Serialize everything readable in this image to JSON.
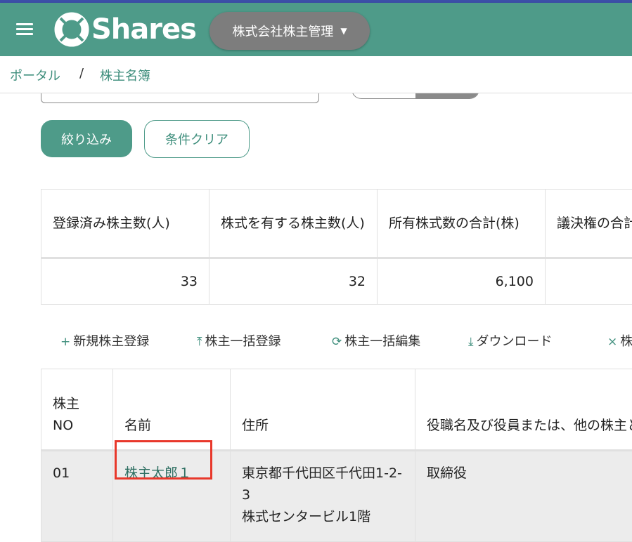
{
  "header": {
    "brand": "Shares",
    "company": "株式会社株主管理",
    "accent_color": "#4e9b89",
    "menu_icon": "hamburger-menu-icon",
    "logo_icon": "shares-lifebuoy-logo"
  },
  "breadcrumb": {
    "items": [
      "ポータル",
      "株主名簿"
    ],
    "separator": "/"
  },
  "filters": {
    "filter_button": "絞り込み",
    "clear_button": "条件クリア"
  },
  "stats": {
    "headers": [
      "登録済み株主数(人)",
      "株式を有する株主数(人)",
      "所有株式数の合計(株)",
      "議決権の合計"
    ],
    "values": [
      "33",
      "32",
      "6,100",
      ""
    ]
  },
  "toolbar": {
    "items": [
      {
        "icon": "plus-icon",
        "glyph": "+",
        "label": "新規株主登録"
      },
      {
        "icon": "upload-icon",
        "glyph": "⤒",
        "label": "株主一括登録"
      },
      {
        "icon": "sync-icon",
        "glyph": "⟳",
        "label": "株主一括編集"
      },
      {
        "icon": "download-icon",
        "glyph": "⤓",
        "label": "ダウンロード"
      },
      {
        "icon": "close-icon",
        "glyph": "×",
        "label": "株"
      }
    ]
  },
  "table": {
    "headers": [
      "株主NO",
      "名前",
      "住所",
      "役職名及び役員または、他の株主との関係"
    ],
    "rows": [
      {
        "no": "01",
        "name": "株主太郎１",
        "address_line1": "東京都千代田区千代田1-2-3",
        "address_line2": "株式センタービル1階",
        "relation": "取締役"
      }
    ]
  }
}
